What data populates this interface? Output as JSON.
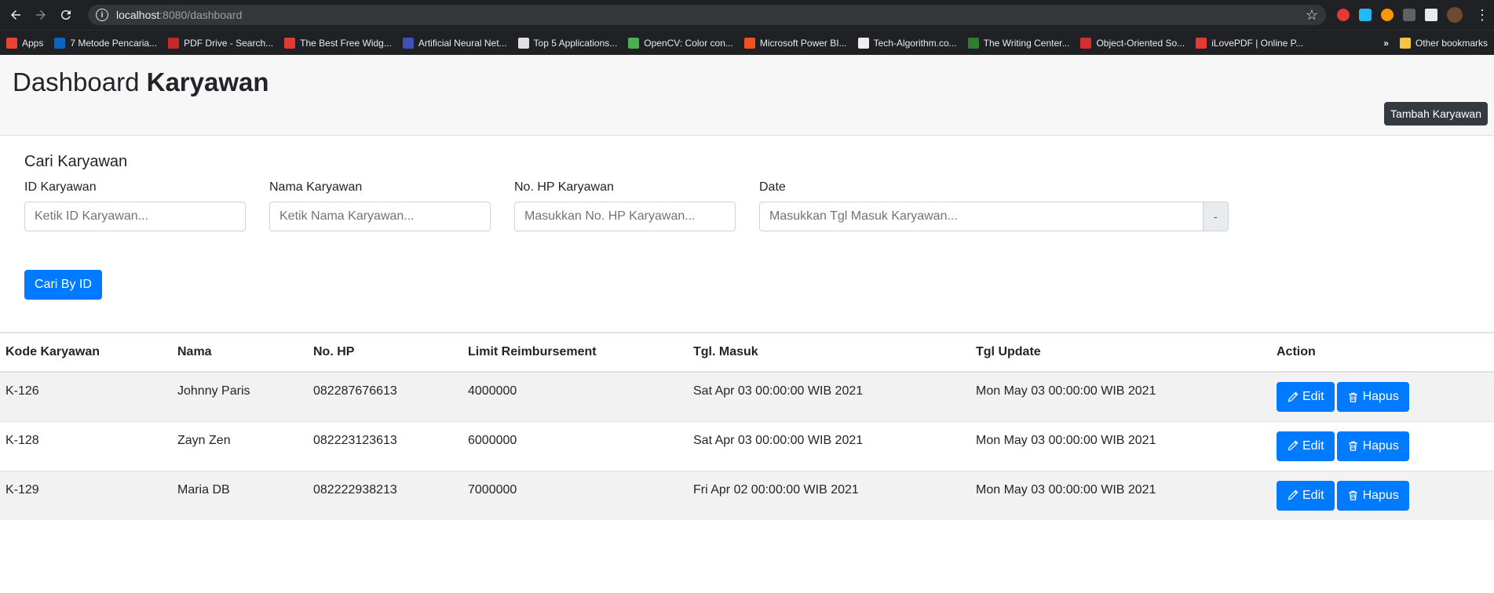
{
  "browser": {
    "url_host": "localhost",
    "url_path": ":8080/dashboard",
    "bookmarks": [
      {
        "label": "Apps",
        "color": "#ea4335"
      },
      {
        "label": "7 Metode Pencaria...",
        "color": "#0a66c2"
      },
      {
        "label": "PDF Drive - Search...",
        "color": "#c62828"
      },
      {
        "label": "The Best Free Widg...",
        "color": "#e53935"
      },
      {
        "label": "Artificial Neural Net...",
        "color": "#3f51b5"
      },
      {
        "label": "Top 5 Applications...",
        "color": "#e0e0e0"
      },
      {
        "label": "OpenCV: Color con...",
        "color": "#4caf50"
      },
      {
        "label": "Microsoft Power BI...",
        "color": "#f25022"
      },
      {
        "label": "Tech-Algorithm.co...",
        "color": "#eeeeee"
      },
      {
        "label": "The Writing Center...",
        "color": "#2e7d32"
      },
      {
        "label": "Object-Oriented So...",
        "color": "#d32f2f"
      },
      {
        "label": "iLovePDF | Online P...",
        "color": "#e53935"
      }
    ],
    "more_label": "»",
    "other_bookmarks": "Other bookmarks"
  },
  "header": {
    "title_regular": "Dashboard ",
    "title_bold": "Karyawan",
    "add_button": "Tambah Karyawan"
  },
  "search": {
    "title": "Cari Karyawan",
    "id_label": "ID Karyawan",
    "id_placeholder": "Ketik ID Karyawan...",
    "nama_label": "Nama Karyawan",
    "nama_placeholder": "Ketik Nama Karyawan...",
    "hp_label": "No. HP Karyawan",
    "hp_placeholder": "Masukkan No. HP Karyawan...",
    "date_label": "Date",
    "date_placeholder": "Masukkan Tgl Masuk Karyawan...",
    "date_addon": "-",
    "submit": "Cari By ID"
  },
  "table": {
    "headers": [
      "Kode Karyawan",
      "Nama",
      "No. HP",
      "Limit Reimbursement",
      "Tgl. Masuk",
      "Tgl Update",
      "Action"
    ],
    "rows": [
      {
        "kode": "K-126",
        "nama": "Johnny Paris",
        "hp": "082287676613",
        "limit": "4000000",
        "masuk": "Sat Apr 03 00:00:00 WIB 2021",
        "update": "Mon May 03 00:00:00 WIB 2021"
      },
      {
        "kode": "K-128",
        "nama": "Zayn Zen",
        "hp": "082223123613",
        "limit": "6000000",
        "masuk": "Sat Apr 03 00:00:00 WIB 2021",
        "update": "Mon May 03 00:00:00 WIB 2021"
      },
      {
        "kode": "K-129",
        "nama": "Maria DB",
        "hp": "082222938213",
        "limit": "7000000",
        "masuk": "Fri Apr 02 00:00:00 WIB 2021",
        "update": "Mon May 03 00:00:00 WIB 2021"
      }
    ],
    "edit_label": "Edit",
    "delete_label": "Hapus"
  }
}
